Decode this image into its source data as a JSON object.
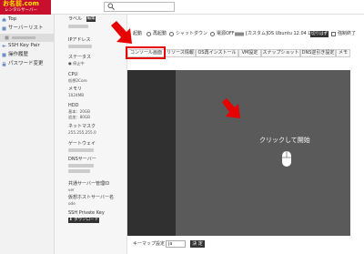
{
  "header": {
    "logo_line1": "お名前.com",
    "logo_line2": "レンタルサーバー",
    "search_placeholder": ""
  },
  "sidebar": {
    "items": [
      {
        "label": "Top"
      },
      {
        "label": "サーバーリスト"
      },
      {
        "label": ""
      },
      {
        "label": "SSH Key Pair"
      },
      {
        "label": "操作履歴"
      },
      {
        "label": "パスワード変更"
      }
    ]
  },
  "info": {
    "label_label": "ラベル",
    "label_edit": "編集",
    "ip_label": "IPアドレス",
    "status_label": "ステータス",
    "status_value": "● 停止中",
    "cpu_label": "CPU",
    "cpu_value": "仮想2Core",
    "memory_label": "メモリ",
    "memory_value": "1024MB",
    "hdd_label": "HDD",
    "hdd_value1": "基本：20GB",
    "hdd_value2": "追加：80GB",
    "netmask_label": "ネットマスク",
    "netmask_value": "255.255.255.0",
    "gateway_label": "ゲートウェイ",
    "dns_label": "DNSサーバー",
    "shared_label": "共通サーバー管理ID",
    "shared_value": "ver",
    "hostname_label": "仮想ホストサーバー名",
    "hostname_value": "ode",
    "sshkey_label": "SSH Private Key",
    "download_label": "⬇ ダウンロード"
  },
  "controls": {
    "start": "起動",
    "restart": "再起動",
    "shutdown": "シャットダウン",
    "poweroff": "電源OFF",
    "os_info": "[カスタム]OS Ubuntu 12.04 LTS",
    "change_button": "切りはず",
    "force_label": "強制終了"
  },
  "tabs": [
    "コンソール画面",
    "リソース情報",
    "OS再インストール",
    "VM設定",
    "スナップショット",
    "DNS逆引き設定",
    "メモ"
  ],
  "console": {
    "click_text": "クリックして開始"
  },
  "bottom": {
    "keymap_label": "キーマップ設定",
    "keymap_value": "ja",
    "send_button": "決 定"
  },
  "colors": {
    "brand_red": "#c8102e",
    "highlight_red": "#e60000",
    "console_bg": "#5a5a5a",
    "console_left": "#303030"
  }
}
